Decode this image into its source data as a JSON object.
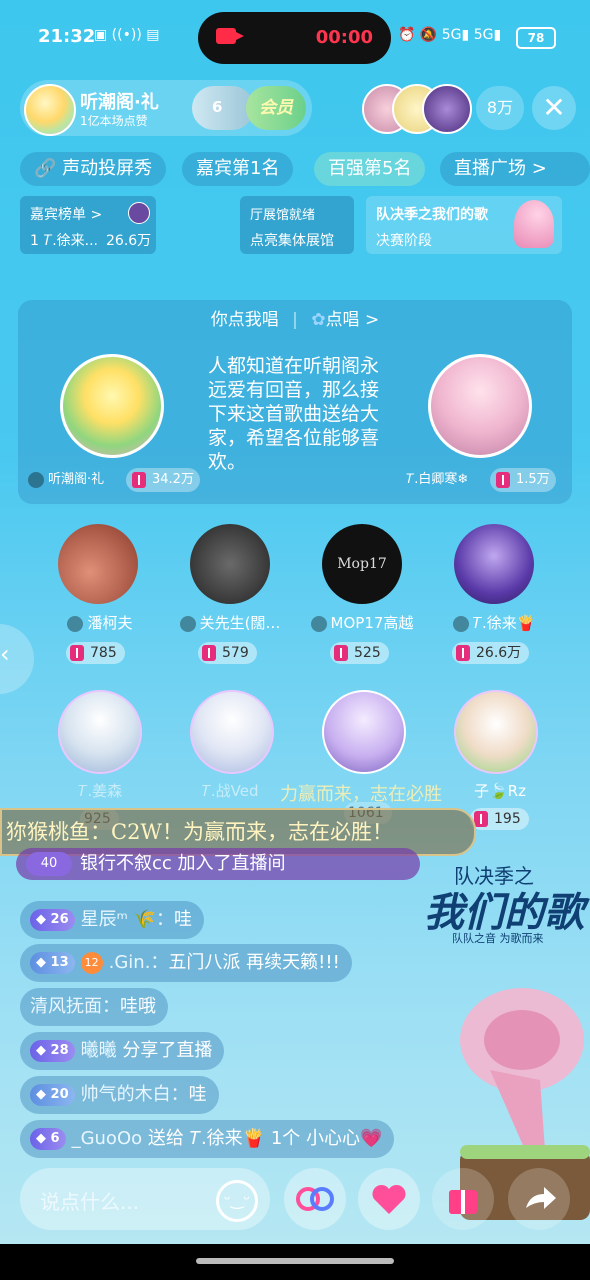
{
  "status": {
    "time": "21:32",
    "record_time": "00:00",
    "battery": "78",
    "signal1": "5G",
    "signal2": "5G"
  },
  "host": {
    "name": "听潮阁·礼",
    "subtitle": "1亿本场点赞",
    "heart_count": "6",
    "member_label": "会员"
  },
  "viewer_count": "8万",
  "tabs": [
    "声动投屏秀",
    "嘉宾第1名",
    "百强第5名",
    "直播广场 >"
  ],
  "cards": {
    "guest_rank_title": "嘉宾榜单 >",
    "guest_rank_entry": "1 𝑇.徐来...",
    "guest_rank_value": "26.6万",
    "hall_l1": "厅展馆就绪",
    "hall_l2": "点亮集体展馆",
    "event_l1": "队决季之我们的歌",
    "event_l2": "决赛阶段"
  },
  "panel": {
    "title": "你点我唱",
    "sing_label": "点唱 >",
    "song_text": "人都知道在听朝阁永远爱有回音，那么接下来这首歌曲送给大家，希望各位能够喜欢。",
    "left_name": "听潮阁·礼",
    "left_value": "34.2万",
    "right_name": "𝑇.白卿寒❄",
    "right_value": "1.5万"
  },
  "seats_row1": [
    {
      "name": "潘柯夫",
      "value": "785"
    },
    {
      "name": "关先生(闊…",
      "value": "579"
    },
    {
      "name": "MOP17高越",
      "value": "525"
    },
    {
      "name": "𝑇.徐来🍟",
      "value": "26.6万"
    }
  ],
  "seats_row2": [
    {
      "name": "𝑇.姜森",
      "value": "925"
    },
    {
      "name": "𝑇.战Ved",
      "value": "1061"
    },
    {
      "name": "",
      "value": ""
    },
    {
      "name": "子🍃Rz",
      "value": "195"
    }
  ],
  "banner_text": "狝猴桃鱼：C2W！为赢而来，志在必胜！",
  "overlay_text": "力赢而来，志在必胜",
  "enter": {
    "level": "40",
    "text": "银行不叙cc 加入了直播间"
  },
  "messages": [
    {
      "badge": "26",
      "badge_type": "purple",
      "name": "星辰ᵐ 🌾：",
      "text": "哇"
    },
    {
      "badge": "13",
      "badge_type": "blue",
      "badge2": "12",
      "name": ".Gin.：",
      "text": "五门八派 再续天籁!!!"
    },
    {
      "badge": "",
      "badge_type": "",
      "name": "清风抚面：",
      "text": "哇哦"
    },
    {
      "badge": "28",
      "badge_type": "purple",
      "name": "曦曦",
      "text": " 分享了直播"
    },
    {
      "badge": "20",
      "badge_type": "blue",
      "name": "帅气的木白：",
      "text": "哇"
    },
    {
      "badge": "6",
      "badge_type": "purple",
      "name": "_GuoOo",
      "text": " 送给 𝑇.徐来🍟 1个 小心心💗"
    }
  ],
  "event_logo": {
    "top": "队决季之",
    "main": "我们的歌",
    "sub": "队队之音 为歌而来"
  },
  "input_placeholder": "说点什么...",
  "colors": {
    "bg_top": "#3ec7ee",
    "bg_bottom": "#b8e8f2",
    "gift": "#e62d7c",
    "accent_pink": "#ff4f9a"
  }
}
